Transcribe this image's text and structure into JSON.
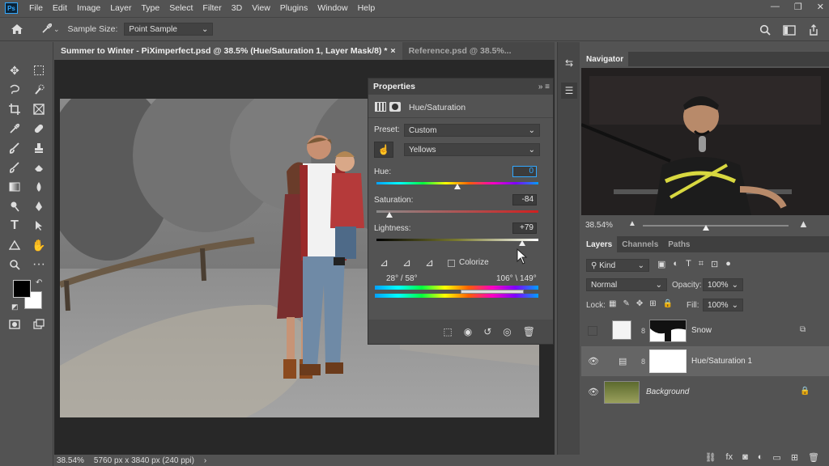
{
  "app": {
    "logo": "Ps"
  },
  "menu": [
    "File",
    "Edit",
    "Image",
    "Layer",
    "Type",
    "Select",
    "Filter",
    "3D",
    "View",
    "Plugins",
    "Window",
    "Help"
  ],
  "window_controls": {
    "minimize": "—",
    "restore": "❐",
    "close": "✕"
  },
  "options_bar": {
    "sample_size_label": "Sample Size:",
    "sample_size_value": "Point Sample"
  },
  "tabs": [
    {
      "label": "Summer to Winter - PiXimperfect.psd @ 38.5% (Hue/Saturation 1, Layer Mask/8) *",
      "close": "×"
    },
    {
      "label": "Reference.psd @ 38.5%..."
    }
  ],
  "status": {
    "zoom": "38.54%",
    "doc_info": "5760 px x 3840 px (240 ppi)",
    "arrow": "›"
  },
  "properties": {
    "title": "Properties",
    "adjustment": "Hue/Saturation",
    "preset_label": "Preset:",
    "preset_value": "Custom",
    "channel_value": "Yellows",
    "hue_label": "Hue:",
    "hue_value": "0",
    "saturation_label": "Saturation:",
    "saturation_value": "-84",
    "lightness_label": "Lightness:",
    "lightness_value": "+79",
    "colorize_label": "Colorize",
    "range_left": "28° / 58°",
    "range_right": "106° \\ 149°",
    "hue_level": 0.5,
    "saturation_level": 0.08,
    "lightness_level": 0.9
  },
  "navigator": {
    "title": "Navigator",
    "zoom": "38.54%"
  },
  "layers_panel": {
    "tabs": [
      "Layers",
      "Channels",
      "Paths"
    ],
    "filter_kind": "Kind",
    "blend_mode": "Normal",
    "opacity_label": "Opacity:",
    "opacity_value": "100%",
    "lock_label": "Lock:",
    "fill_label": "Fill:",
    "fill_value": "100%",
    "layers": [
      {
        "name": "Snow",
        "visible": false
      },
      {
        "name": "Hue/Saturation 1",
        "visible": true,
        "selected": true
      },
      {
        "name": "Background",
        "visible": true,
        "locked": true
      }
    ]
  },
  "colors": {
    "ui_bg": "#535353",
    "panel_dark": "#424242",
    "accent_blue": "#31a8ff",
    "canvas_bg": "#282828"
  }
}
